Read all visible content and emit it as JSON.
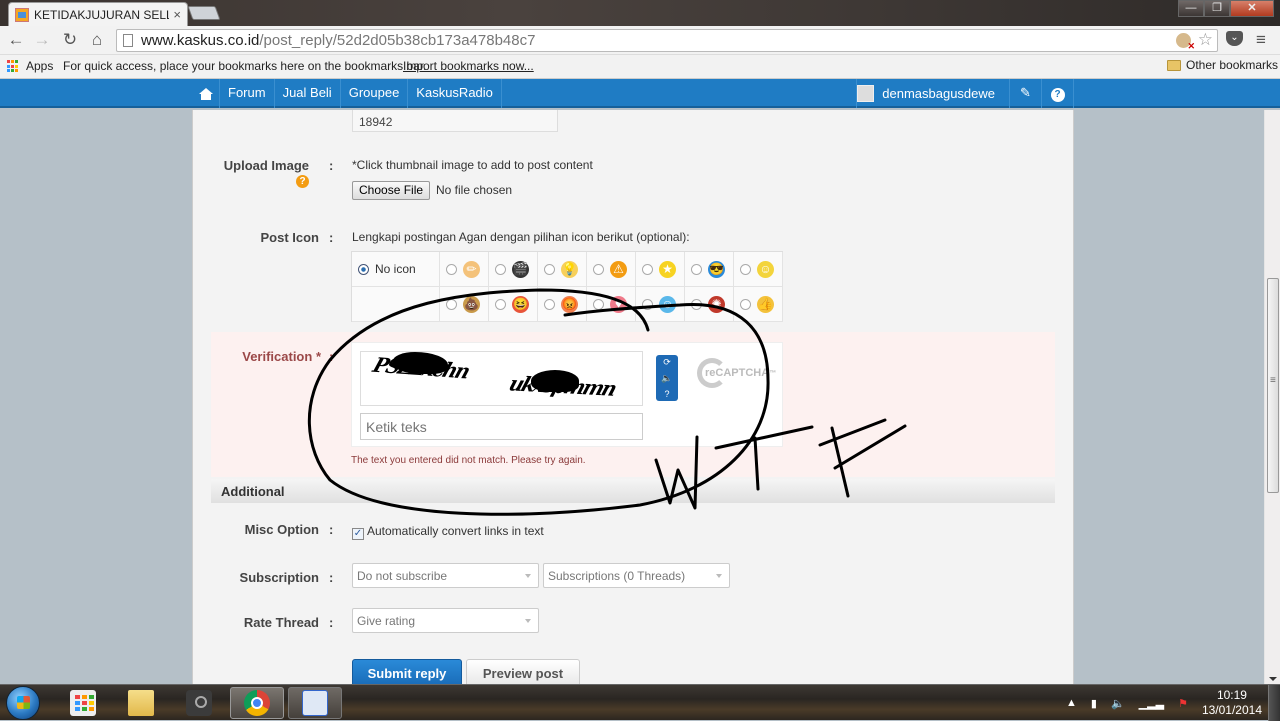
{
  "browser": {
    "tab_title": "KETIDAKJUJURAN SELLER",
    "tab_close": "×",
    "url_host": "www.kaskus.co.id",
    "url_path": "/post_reply/52d2d05b38cb173a478b48c7",
    "nav_icons": {
      "back": "←",
      "forward": "→",
      "reload": "↻",
      "home": "⌂"
    },
    "star": "☆",
    "menu": "≡",
    "window_buttons": {
      "minimize": "—",
      "maximize": "❐",
      "close": "✕"
    }
  },
  "bookmarks": {
    "apps_label": "Apps",
    "hint": "For quick access, place your bookmarks here on the bookmarks bar.",
    "import_link": "Import bookmarks now...",
    "other": "Other bookmarks",
    "apps_colors": [
      "#e44",
      "#f90",
      "#3a3",
      "#39f",
      "#e44",
      "#fc0",
      "#39f",
      "#3a3",
      "#f90"
    ]
  },
  "navbar": {
    "items": [
      "Forum",
      "Jual Beli",
      "Groupee",
      "KaskusRadio"
    ],
    "username": "denmasbagusdewe",
    "pencil": "✎",
    "help": "?"
  },
  "form": {
    "previous_value": "18942",
    "upload": {
      "label": "Upload Image",
      "help": "?",
      "hint": "*Click thumbnail image to add to post content",
      "choose_file": "Choose File",
      "no_file": "No file chosen"
    },
    "post_icon": {
      "label": "Post Icon",
      "hint": "Lengkapi postingan Agan dengan pilihan icon berikut (optional):",
      "no_icon": "No icon",
      "selected": "No icon",
      "row1": [
        {
          "name": "pencil",
          "glyph": "✏",
          "bg": "#f4c27a"
        },
        {
          "name": "clapperboard",
          "glyph": "🎬",
          "bg": "#333"
        },
        {
          "name": "lightbulb",
          "glyph": "💡",
          "bg": "#f7d05a"
        },
        {
          "name": "warning",
          "glyph": "⚠",
          "bg": "#f39c12"
        },
        {
          "name": "star",
          "glyph": "★",
          "bg": "#f7d322"
        },
        {
          "name": "cool",
          "glyph": "😎",
          "bg": "#2a8ad8"
        },
        {
          "name": "smile",
          "glyph": "☺",
          "bg": "#f3d43c"
        }
      ],
      "row2": [
        {
          "name": "poop",
          "glyph": "💩",
          "bg": "#c99a4a"
        },
        {
          "name": "laugh",
          "glyph": "😆",
          "bg": "#e8553a"
        },
        {
          "name": "angry",
          "glyph": "😡",
          "bg": "#f08050"
        },
        {
          "name": "heart",
          "glyph": "♥",
          "bg": "#f07a8a"
        },
        {
          "name": "happy",
          "glyph": "☺",
          "bg": "#5ab8ea"
        },
        {
          "name": "burst",
          "glyph": "✺",
          "bg": "#c0392b"
        },
        {
          "name": "thumbs-up",
          "glyph": "👍",
          "bg": "#f3c23c"
        }
      ]
    },
    "verification": {
      "label": "Verification",
      "required": "*",
      "captcha_text_1": "PSZZxchn",
      "captcha_text_2": "ukxspmmn",
      "input_placeholder": "Ketik teks",
      "error": "The text you entered did not match. Please try again.",
      "recaptcha_label": "reCAPTCHA",
      "recaptcha_tm": "™"
    },
    "additional": {
      "title": "Additional",
      "misc_label": "Misc Option",
      "misc_checkbox_label": "Automatically convert links in text",
      "misc_checked": true,
      "subscription_label": "Subscription",
      "subscription_value": "Do not subscribe",
      "subscriptions_value": "Subscriptions (0 Threads)",
      "rate_label": "Rate Thread",
      "rate_value": "Give rating"
    },
    "colon": ":",
    "submit": "Submit reply",
    "preview": "Preview post"
  },
  "annotation": {
    "text": "WTF",
    "color": "#000000"
  },
  "taskbar": {
    "apps": [
      "apps-grid",
      "file-explorer",
      "steam",
      "chrome",
      "aiseesoft"
    ],
    "active": "chrome",
    "time": "10:19",
    "date": "13/01/2014"
  }
}
